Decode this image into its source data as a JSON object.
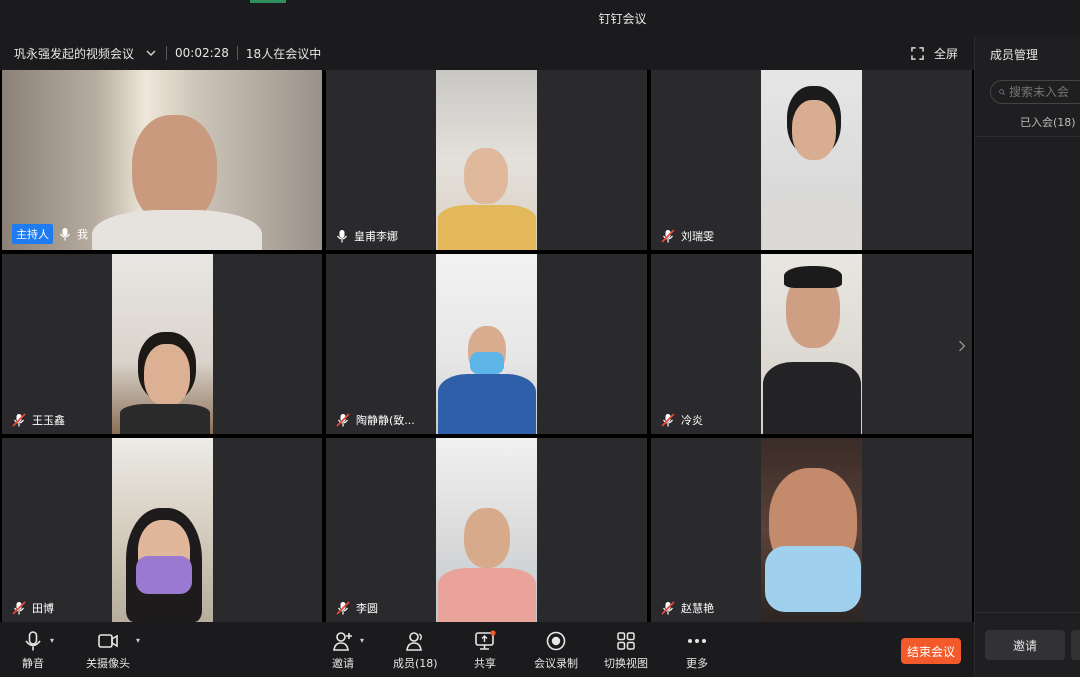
{
  "window": {
    "title": "钉钉会议"
  },
  "infobar": {
    "meeting_title": "巩永强发起的视频会议",
    "timer": "00:02:28",
    "participants": "18人在会议中",
    "fullscreen_label": "全屏"
  },
  "participants": [
    {
      "name": "我",
      "host_label": "主持人",
      "muted": false,
      "is_host": true
    },
    {
      "name": "皇甫李娜",
      "muted": false
    },
    {
      "name": "刘瑞雯",
      "muted": true
    },
    {
      "name": "王玉鑫",
      "muted": true
    },
    {
      "name": "陶静静(致...",
      "muted": true
    },
    {
      "name": "冷炎",
      "muted": true
    },
    {
      "name": "田博",
      "muted": true
    },
    {
      "name": "李圆",
      "muted": true
    },
    {
      "name": "赵慧艳",
      "muted": true
    }
  ],
  "panel": {
    "title": "成员管理",
    "search_placeholder": "搜索未入会",
    "joined": "已入会(18)",
    "invite_label": "邀请"
  },
  "toolbar": {
    "mute": "静音",
    "camera_off": "关摄像头",
    "invite": "邀请",
    "members": "成员(18)",
    "share": "共享",
    "record": "会议录制",
    "switch_view": "切换视图",
    "more": "更多",
    "end_meeting": "结束会议"
  },
  "colors": {
    "host_badge": "#1e7bf0",
    "end_button": "#f25a2b",
    "share_dot": "#f25a2b"
  }
}
